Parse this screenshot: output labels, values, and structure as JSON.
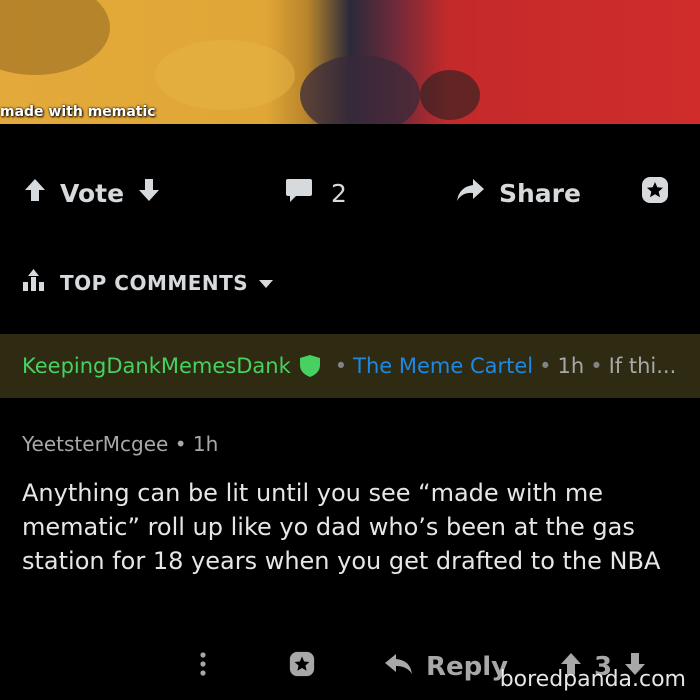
{
  "meme": {
    "watermark": "made with mematic"
  },
  "post_actions": {
    "vote_label": "Vote",
    "comment_count": "2",
    "share_label": "Share"
  },
  "top_comments": {
    "label": "TOP COMMENTS"
  },
  "pinned_comment": {
    "user": "KeepingDankMemesDank",
    "flair": "The Meme Cartel",
    "time": "1h",
    "snippet": "If thi...",
    "separator": "•"
  },
  "comment": {
    "user": "YeetsterMcgee",
    "time": "1h",
    "separator": "•",
    "body": "Anything can be lit until you see “made with me mematic” roll up like yo dad who’s been at the gas station for 18 years when you get drafted to the NBA"
  },
  "comment_actions": {
    "reply_label": "Reply",
    "vote_count": "3"
  },
  "site_watermark": "boredpanda.com",
  "colors": {
    "background": "#000000",
    "pinned_bg": "#2f2a12",
    "user_green": "#46d160",
    "flair_blue": "#1e88e5",
    "text_muted": "#a8a8a8"
  }
}
